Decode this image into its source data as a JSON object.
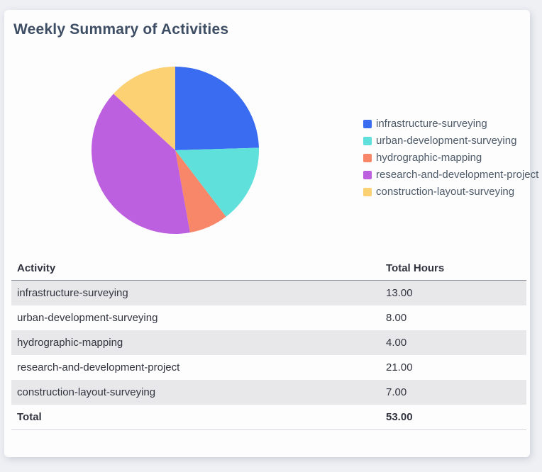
{
  "page": {
    "title": "Weekly Summary of Activities"
  },
  "chart_data": {
    "type": "pie",
    "title": "Weekly Summary of Activities",
    "labels": [
      "infrastructure-surveying",
      "urban-development-surveying",
      "hydrographic-mapping",
      "research-and-development-project",
      "construction-layout-surveying"
    ],
    "values": [
      13,
      8,
      4,
      21,
      7
    ],
    "colors": [
      "#3a6cf1",
      "#5fe0da",
      "#f8876a",
      "#bd60e0",
      "#fcd173"
    ],
    "total": 53,
    "start_angle_deg": 0,
    "direction": "clockwise",
    "legend_position": "right"
  },
  "table": {
    "columns": [
      "Activity",
      "Total Hours"
    ],
    "rows": [
      {
        "activity": "infrastructure-surveying",
        "hours": "13.00"
      },
      {
        "activity": "urban-development-surveying",
        "hours": "8.00"
      },
      {
        "activity": "hydrographic-mapping",
        "hours": "4.00"
      },
      {
        "activity": "research-and-development-project",
        "hours": "21.00"
      },
      {
        "activity": "construction-layout-surveying",
        "hours": "7.00"
      }
    ],
    "total_row": {
      "label": "Total",
      "value": "53.00"
    }
  },
  "colors": {
    "page_background": "#eef0f4",
    "card_background": "#fdfdfe",
    "title_text": "#3d4d63",
    "legend_text": "#4d5a68",
    "table_text": "#31333f",
    "stripe_row": "#e8e8ea",
    "header_border": "#8a8e96"
  }
}
